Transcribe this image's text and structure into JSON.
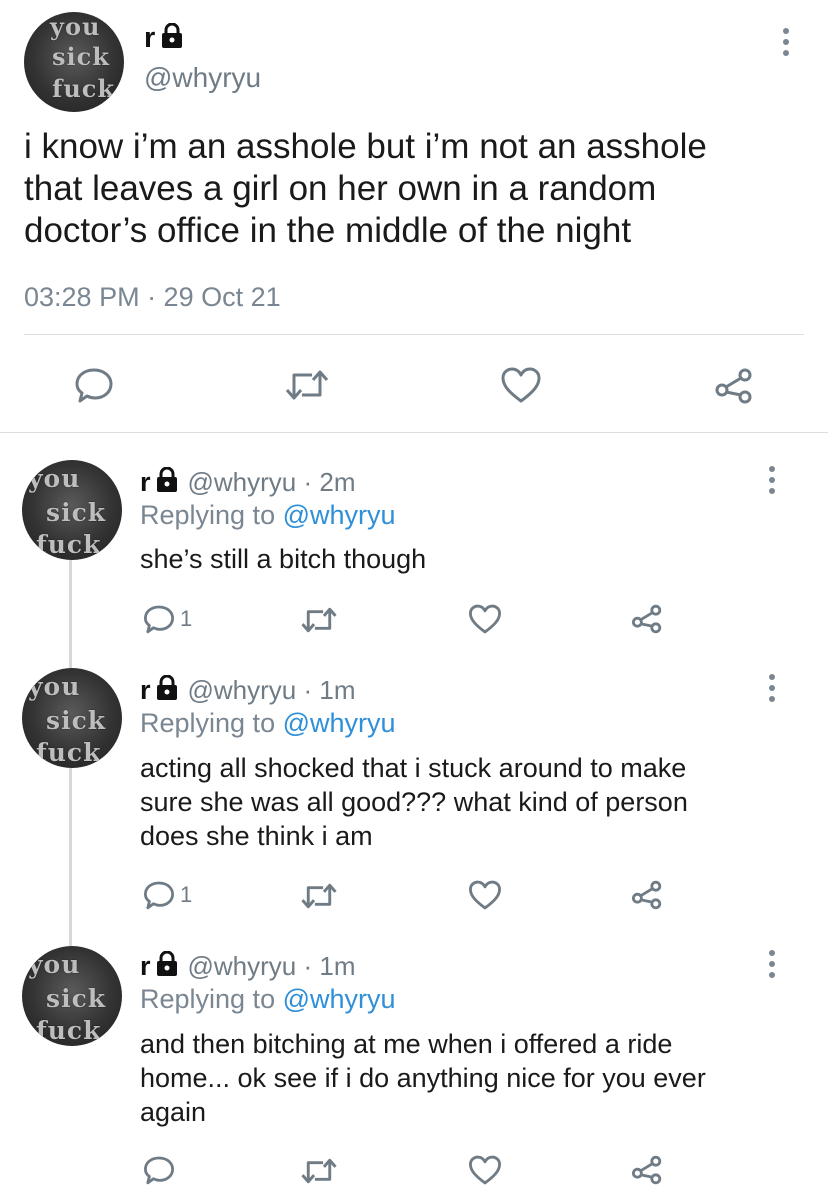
{
  "main_tweet": {
    "author_name": "r",
    "handle": "@whyryu",
    "avatar_text": [
      "you",
      "sick",
      "fuck"
    ],
    "text_lines": [
      "i know i’m an asshole but i’m not an asshole",
      "that leaves a girl on her own in a random",
      "doctor’s office in the middle of the night"
    ],
    "timestamp": "03:28 PM · 29 Oct 21"
  },
  "replies": [
    {
      "author_name": "r",
      "handle_time": "@whyryu · 2m",
      "replying_prefix": "Replying to ",
      "replying_to": "@whyryu",
      "text_lines": [
        "she’s still a bitch though"
      ],
      "reply_count": "1"
    },
    {
      "author_name": "r",
      "handle_time": "@whyryu · 1m",
      "replying_prefix": "Replying to ",
      "replying_to": "@whyryu",
      "text_lines": [
        "acting all shocked that i stuck around to make",
        "sure she was all good??? what kind of person",
        "does she think i am"
      ],
      "reply_count": "1"
    },
    {
      "author_name": "r",
      "handle_time": "@whyryu · 1m",
      "replying_prefix": "Replying to ",
      "replying_to": "@whyryu",
      "text_lines": [
        "and then bitching at me when i offered a ride",
        "home... ok see if i do anything nice for you ever",
        "again"
      ],
      "reply_count": ""
    }
  ],
  "icons": [
    "more-icon",
    "lock-icon",
    "reply-icon",
    "retweet-icon",
    "like-icon",
    "share-icon"
  ],
  "colors": {
    "link": "#2f8fd8",
    "muted": "#7a8691",
    "divider": "#dcdfe2"
  }
}
